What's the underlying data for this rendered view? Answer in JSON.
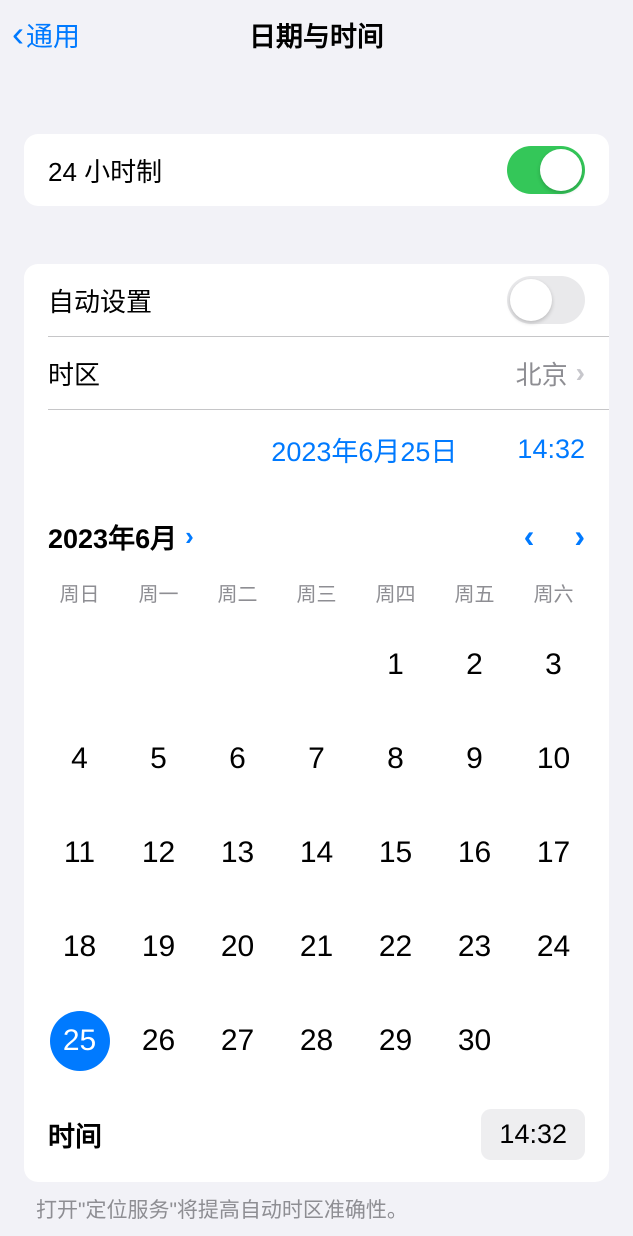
{
  "header": {
    "back_label": "通用",
    "title": "日期与时间"
  },
  "settings": {
    "twenty_four_hour_label": "24 小时制",
    "auto_set_label": "自动设置",
    "timezone_label": "时区",
    "timezone_value": "北京"
  },
  "datetime": {
    "date_display": "2023年6月25日",
    "time_display": "14:32"
  },
  "calendar": {
    "month_year": "2023年6月",
    "weekdays": [
      "周日",
      "周一",
      "周二",
      "周三",
      "周四",
      "周五",
      "周六"
    ],
    "leading_blanks": 4,
    "days": [
      1,
      2,
      3,
      4,
      5,
      6,
      7,
      8,
      9,
      10,
      11,
      12,
      13,
      14,
      15,
      16,
      17,
      18,
      19,
      20,
      21,
      22,
      23,
      24,
      25,
      26,
      27,
      28,
      29,
      30
    ],
    "selected_day": 25
  },
  "time_row": {
    "label": "时间",
    "value": "14:32"
  },
  "footer": "打开\"定位服务\"将提高自动时区准确性。"
}
